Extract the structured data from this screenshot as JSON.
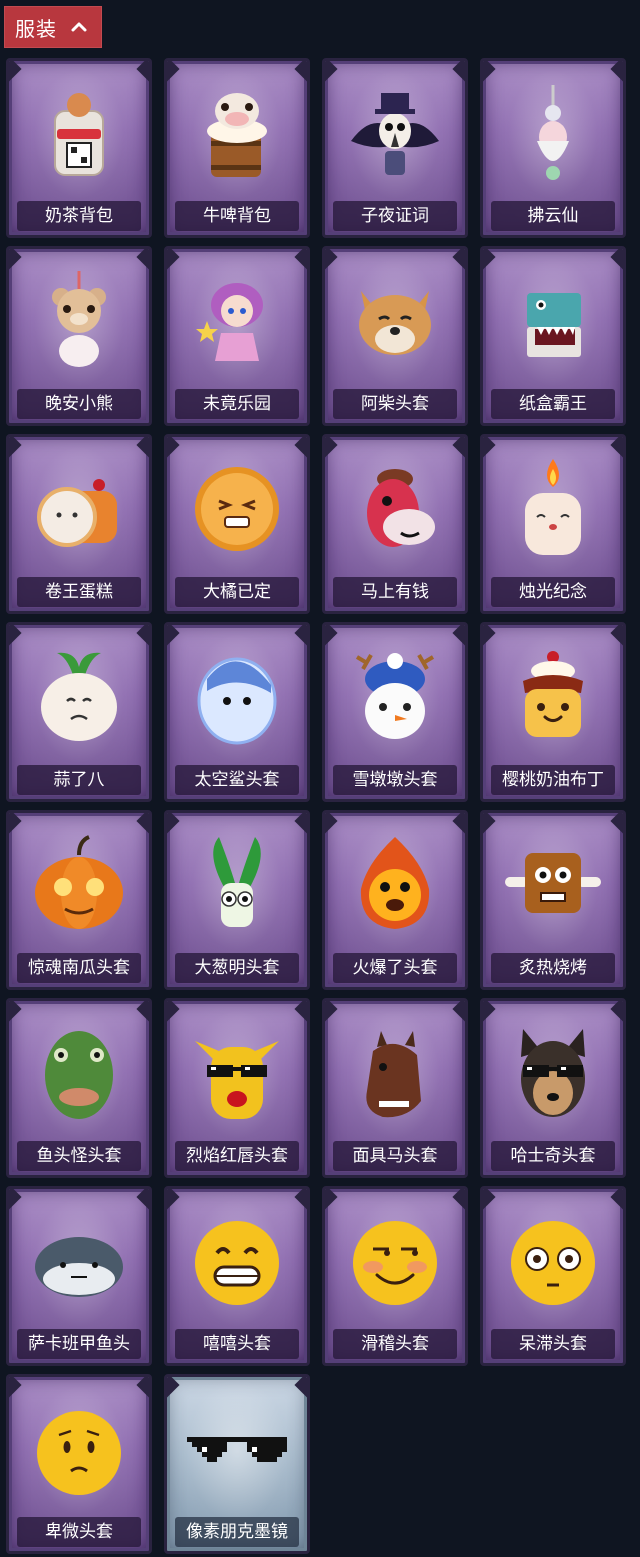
{
  "section": {
    "label": "服装",
    "chevron_icon": "chevron-up-icon",
    "accent_color": "#b8373e"
  },
  "items": [
    {
      "label": "奶茶背包",
      "icon": "milk-tea-backpack-icon",
      "rarity": "purple"
    },
    {
      "label": "牛啤背包",
      "icon": "beer-barrel-cow-backpack-icon",
      "rarity": "purple"
    },
    {
      "label": "子夜证词",
      "icon": "plague-doctor-bird-icon",
      "rarity": "purple"
    },
    {
      "label": "拂云仙",
      "icon": "fairy-charm-pendant-icon",
      "rarity": "purple"
    },
    {
      "label": "晚安小熊",
      "icon": "teddy-bear-pendant-icon",
      "rarity": "purple"
    },
    {
      "label": "未竟乐园",
      "icon": "magical-girl-figure-icon",
      "rarity": "purple"
    },
    {
      "label": "阿柴头套",
      "icon": "shiba-dog-head-icon",
      "rarity": "purple"
    },
    {
      "label": "纸盒霸王",
      "icon": "cardboard-dino-box-icon",
      "rarity": "purple"
    },
    {
      "label": "卷王蛋糕",
      "icon": "roll-cake-icon",
      "rarity": "purple"
    },
    {
      "label": "大橘已定",
      "icon": "orange-slice-face-icon",
      "rarity": "purple"
    },
    {
      "label": "马上有钱",
      "icon": "pink-horse-head-icon",
      "rarity": "purple"
    },
    {
      "label": "烛光纪念",
      "icon": "candle-face-icon",
      "rarity": "purple"
    },
    {
      "label": "蒜了八",
      "icon": "garlic-face-icon",
      "rarity": "purple"
    },
    {
      "label": "太空鲨头套",
      "icon": "shark-egg-head-icon",
      "rarity": "purple"
    },
    {
      "label": "雪墩墩头套",
      "icon": "snowman-reindeer-head-icon",
      "rarity": "purple"
    },
    {
      "label": "樱桃奶油布丁",
      "icon": "cherry-pudding-icon",
      "rarity": "purple"
    },
    {
      "label": "惊魂南瓜头套",
      "icon": "pumpkin-head-icon",
      "rarity": "purple"
    },
    {
      "label": "大葱明头套",
      "icon": "green-onion-head-icon",
      "rarity": "purple"
    },
    {
      "label": "火爆了头套",
      "icon": "fire-spirit-head-icon",
      "rarity": "purple"
    },
    {
      "label": "炙热烧烤",
      "icon": "bbq-meat-head-icon",
      "rarity": "purple"
    },
    {
      "label": "鱼头怪头套",
      "icon": "fish-man-head-icon",
      "rarity": "purple"
    },
    {
      "label": "烈焰红唇头套",
      "icon": "yellow-pikachu-shades-head-icon",
      "rarity": "purple"
    },
    {
      "label": "面具马头套",
      "icon": "horse-mask-head-icon",
      "rarity": "purple"
    },
    {
      "label": "哈士奇头套",
      "icon": "husky-shades-head-icon",
      "rarity": "purple"
    },
    {
      "label": "萨卡班甲鱼头",
      "icon": "sacabambaspis-fish-head-icon",
      "rarity": "purple"
    },
    {
      "label": "嘻嘻头套",
      "icon": "grinning-emoji-head-icon",
      "rarity": "purple"
    },
    {
      "label": "滑稽头套",
      "icon": "smirk-emoji-head-icon",
      "rarity": "purple"
    },
    {
      "label": "呆滞头套",
      "icon": "dazed-emoji-head-icon",
      "rarity": "purple"
    },
    {
      "label": "卑微头套",
      "icon": "humble-emoji-head-icon",
      "rarity": "purple"
    },
    {
      "label": "像素朋克墨镜",
      "icon": "pixel-sunglasses-icon",
      "rarity": "blue"
    }
  ],
  "colors": {
    "background": "#0f1521",
    "card_purple": "#8e6cb0",
    "card_blue": "#a9bccd",
    "label_text": "#ffffff"
  }
}
